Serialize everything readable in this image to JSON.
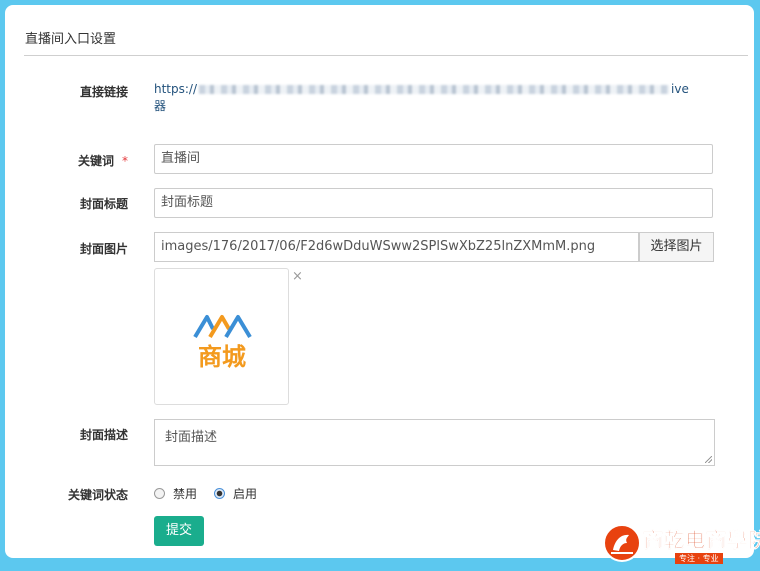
{
  "page": {
    "title": "直播间入口设置"
  },
  "form": {
    "direct_link": {
      "label": "直接链接",
      "value_start": "https://",
      "value_end": "ive",
      "value_line2": "器"
    },
    "keyword": {
      "label": "关键词",
      "required_mark": "*",
      "value": "直播间"
    },
    "cover_title": {
      "label": "封面标题",
      "value": "封面标题"
    },
    "cover_image": {
      "label": "封面图片",
      "value": "images/176/2017/06/F2d6wDduWSww2SPlSwXbZ25lnZXMmM.png",
      "choose_button": "选择图片",
      "thumbnail_text": "商城",
      "remove_icon": "×"
    },
    "cover_desc": {
      "label": "封面描述",
      "placeholder": "封面描述"
    },
    "keyword_status": {
      "label": "关键词状态",
      "options": [
        {
          "label": "禁用",
          "checked": false
        },
        {
          "label": "启用",
          "checked": true
        }
      ]
    },
    "submit_label": "提交"
  },
  "watermark": {
    "text": "商乾电商學院",
    "subtext": "专注 · 专业"
  },
  "colors": {
    "background": "#5cc8ef",
    "submit": "#1aad8d",
    "required": "#e4393c",
    "link": "#23527c",
    "logo_blue": "#3b8fd6",
    "logo_orange": "#f39a1e"
  }
}
